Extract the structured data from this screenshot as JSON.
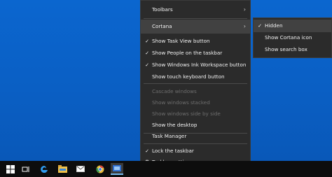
{
  "menu": {
    "toolbars": "Toolbars",
    "cortana": "Cortana",
    "show_task_view": "Show Task View button",
    "show_people": "Show People on the taskbar",
    "show_ink": "Show Windows Ink Workspace button",
    "show_touch_kb": "Show touch keyboard button",
    "cascade": "Cascade windows",
    "stacked": "Show windows stacked",
    "side_by_side": "Show windows side by side",
    "show_desktop": "Show the desktop",
    "task_manager": "Task Manager",
    "lock_taskbar": "Lock the taskbar",
    "taskbar_settings": "Taskbar settings"
  },
  "submenu": {
    "hidden": "Hidden",
    "show_icon": "Show Cortana icon",
    "show_search": "Show search box"
  },
  "glyphs": {
    "check": "✓",
    "chevron": "›",
    "gear": "⚙"
  },
  "taskbar": {
    "icons": [
      "windows-start-icon",
      "task-view-icon",
      "edge-icon",
      "file-explorer-icon",
      "mail-icon",
      "chrome-icon",
      "taskbar-app-icon"
    ]
  },
  "colors": {
    "desktop": "#0a5fc4",
    "menu_bg": "#2b2b2b",
    "highlight": "#414141",
    "taskbar": "#0d0d0d",
    "accent": "#76b9ed"
  }
}
